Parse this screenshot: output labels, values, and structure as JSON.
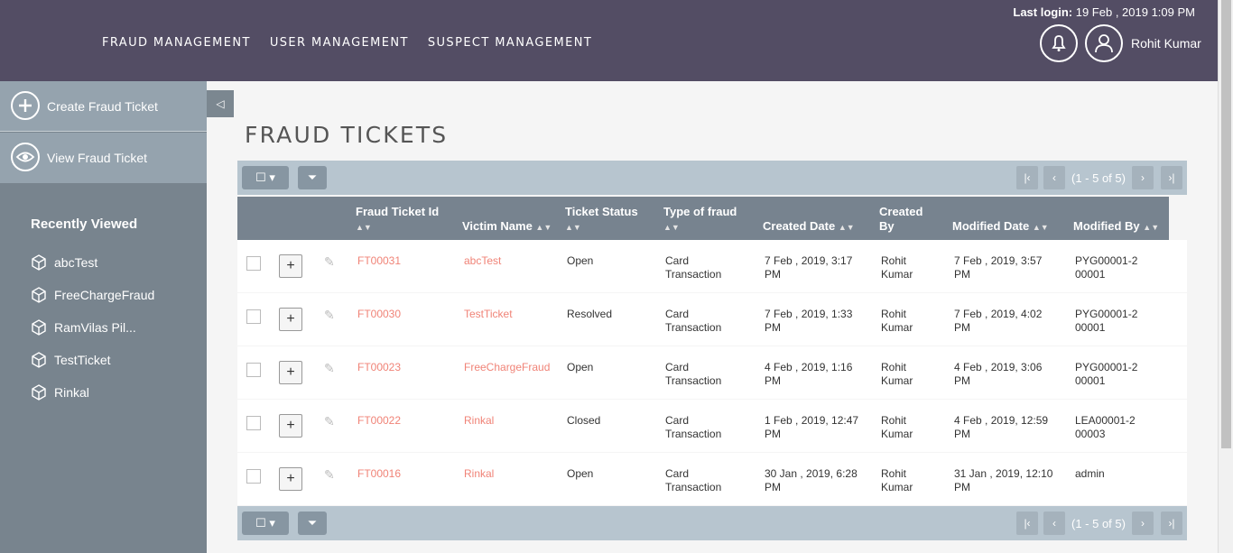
{
  "header": {
    "nav": [
      "FRAUD MANAGEMENT",
      "USER MANAGEMENT",
      "SUSPECT MANAGEMENT"
    ],
    "last_login_label": "Last login:",
    "last_login_value": "19 Feb , 2019 1:09 PM",
    "user_name": "Rohit Kumar"
  },
  "sidebar": {
    "actions": [
      "Create Fraud Ticket",
      "View Fraud Ticket"
    ],
    "recent_title": "Recently Viewed",
    "recent_items": [
      "abcTest",
      "FreeChargeFraud",
      "RamVilas Pil...",
      "TestTicket",
      "Rinkal"
    ]
  },
  "page": {
    "title": "FRAUD TICKETS",
    "pagination": "(1 - 5 of 5)"
  },
  "table": {
    "columns": [
      "Fraud Ticket Id",
      "Victim Name",
      "Ticket Status",
      "Type of fraud",
      "Created Date",
      "Created By",
      "Modified Date",
      "Modified By"
    ],
    "rows": [
      {
        "id": "FT00031",
        "victim": "abcTest",
        "status": "Open",
        "type": "Card Transaction",
        "created": "7 Feb , 2019, 3:17 PM",
        "created_by": "Rohit Kumar",
        "modified": "7 Feb , 2019, 3:57 PM",
        "modified_by": "PYG00001-200001"
      },
      {
        "id": "FT00030",
        "victim": "TestTicket",
        "status": "Resolved",
        "type": "Card Transaction",
        "created": "7 Feb , 2019, 1:33 PM",
        "created_by": "Rohit Kumar",
        "modified": "7 Feb , 2019, 4:02 PM",
        "modified_by": "PYG00001-200001"
      },
      {
        "id": "FT00023",
        "victim": "FreeChargeFraud",
        "status": "Open",
        "type": "Card Transaction",
        "created": "4 Feb , 2019, 1:16 PM",
        "created_by": "Rohit Kumar",
        "modified": "4 Feb , 2019, 3:06 PM",
        "modified_by": "PYG00001-200001"
      },
      {
        "id": "FT00022",
        "victim": "Rinkal",
        "status": "Closed",
        "type": "Card Transaction",
        "created": "1 Feb , 2019, 12:47 PM",
        "created_by": "Rohit Kumar",
        "modified": "4 Feb , 2019, 12:59 PM",
        "modified_by": "LEA00001-200003"
      },
      {
        "id": "FT00016",
        "victim": "Rinkal",
        "status": "Open",
        "type": "Card Transaction",
        "created": "30 Jan , 2019, 6:28 PM",
        "created_by": "Rohit Kumar",
        "modified": "31 Jan , 2019, 12:10 PM",
        "modified_by": "admin"
      }
    ]
  },
  "colors": {
    "header_bg": "#534d64",
    "sidebar_bg": "#78848e",
    "sidebar_action_bg": "#95a3ae",
    "link": "#f08377"
  }
}
